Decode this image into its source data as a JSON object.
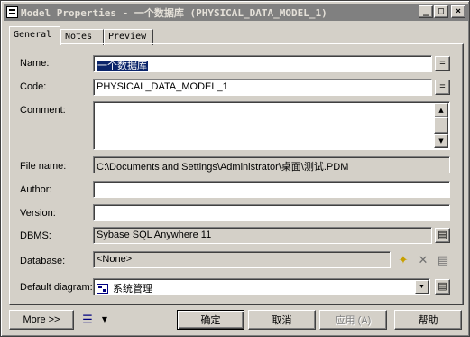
{
  "window": {
    "title": "Model Properties - 一个数据库 (PHYSICAL_DATA_MODEL_1)",
    "buttons": {
      "minimize": "_",
      "maximize": "□",
      "close": "×"
    }
  },
  "tabs": [
    {
      "label": "General",
      "active": true
    },
    {
      "label": "Notes",
      "active": false
    },
    {
      "label": "Preview",
      "active": false
    }
  ],
  "form": {
    "name": {
      "label": "Name:",
      "value": "一个数据库"
    },
    "code": {
      "label": "Code:",
      "value": "PHYSICAL_DATA_MODEL_1"
    },
    "comment": {
      "label": "Comment:",
      "value": ""
    },
    "file_name": {
      "label": "File name:",
      "value": "C:\\Documents and Settings\\Administrator\\桌面\\测试.PDM"
    },
    "author": {
      "label": "Author:",
      "value": ""
    },
    "version": {
      "label": "Version:",
      "value": ""
    },
    "dbms": {
      "label": "DBMS:",
      "value": "Sybase SQL Anywhere 11"
    },
    "database": {
      "label": "Database:",
      "value": "<None>"
    },
    "default_diagram": {
      "label": "Default diagram:",
      "value": "系统管理"
    },
    "equals_button": "="
  },
  "icons": {
    "properties": "properties-icon",
    "new": "new-icon",
    "delete": "delete-icon",
    "diagram": "diagram-icon",
    "menu": "menu-icon"
  },
  "footer": {
    "more": "More >>",
    "ok": "确定",
    "cancel": "取消",
    "apply": "应用 (A)",
    "help": "帮助"
  },
  "colors": {
    "titlebar": "#808080",
    "dialog": "#d4d0c8",
    "selection": "#0a246a"
  }
}
